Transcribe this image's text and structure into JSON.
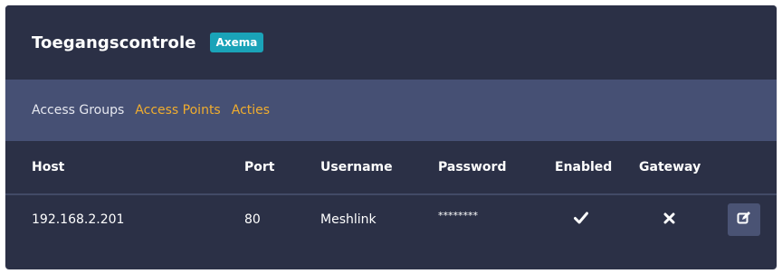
{
  "header": {
    "title": "Toegangscontrole",
    "badge": "Axema"
  },
  "tabs": [
    {
      "label": "Access Groups",
      "active": false
    },
    {
      "label": "Access Points",
      "active": true
    },
    {
      "label": "Acties",
      "active": true
    }
  ],
  "table": {
    "columns": [
      "Host",
      "Port",
      "Username",
      "Password",
      "Enabled",
      "Gateway"
    ],
    "rows": [
      {
        "host": "192.168.2.201",
        "port": "80",
        "username": "Meshlink",
        "password": "********",
        "enabled_icon": "checkmark-icon",
        "gateway_icon": "x-icon",
        "action_icon": "edit-icon"
      }
    ]
  },
  "colors": {
    "panel_bg": "#2b3046",
    "tabs_bg": "#465074",
    "accent_tab": "#f0ad2e",
    "badge_bg": "#1aa3b8"
  }
}
